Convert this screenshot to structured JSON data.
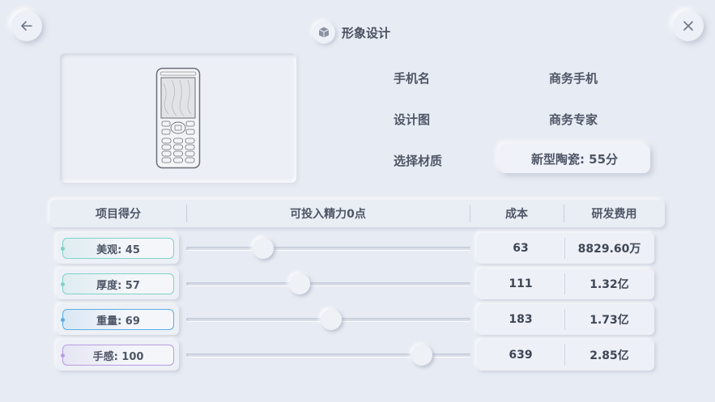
{
  "header": {
    "title": "形象设计",
    "cube_icon": "cube-icon"
  },
  "nav": {
    "back_icon": "arrow-left-icon",
    "close_icon": "close-icon"
  },
  "phone_info": {
    "name_label": "手机名",
    "name_value": "商务手机",
    "design_label": "设计图",
    "design_value": "商务专家",
    "material_label": "选择材质",
    "material_value": "新型陶瓷: 55分"
  },
  "table": {
    "columns": [
      "项目得分",
      "可投入精力0点",
      "成本",
      "研发费用"
    ],
    "rows": [
      {
        "label": "美观: 45",
        "color": "#7fd3c9",
        "slider": 0.27,
        "cost": "63",
        "fee": "8829.60万"
      },
      {
        "label": "厚度: 57",
        "color": "#7fd3c9",
        "slider": 0.4,
        "cost": "111",
        "fee": "1.32亿"
      },
      {
        "label": "重量: 69",
        "color": "#5aaee6",
        "slider": 0.51,
        "cost": "183",
        "fee": "1.73亿"
      },
      {
        "label": "手感: 100",
        "color": "#b99be4",
        "slider": 0.83,
        "cost": "639",
        "fee": "2.85亿"
      }
    ]
  }
}
